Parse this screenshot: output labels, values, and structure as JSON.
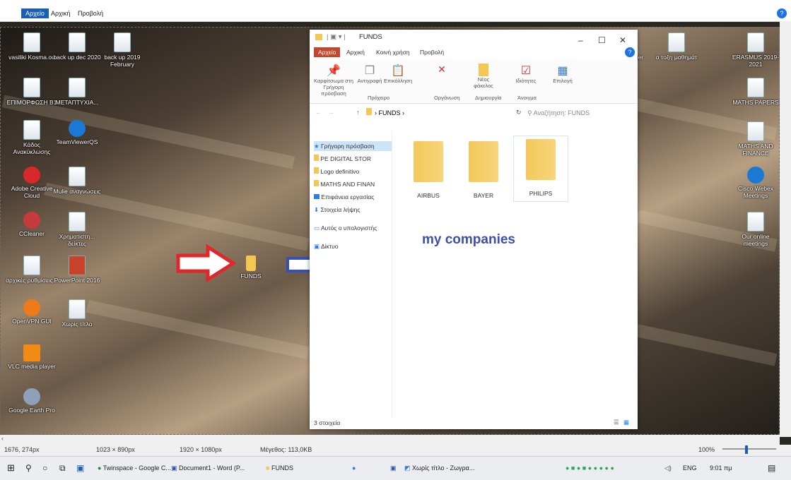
{
  "paint": {
    "tabs": [
      "Αρχείο",
      "Αρχική",
      "Προβολή"
    ]
  },
  "desktop_icons": [
    {
      "label": "vasiliki Kosma.ou"
    },
    {
      "label": "back up dec 2020"
    },
    {
      "label": "back up 2019 February"
    },
    {
      "label": "ΕΠΙΜΟΡΦΩΣΗ Β1"
    },
    {
      "label": "ΜΕΤΑΠΤΥΧΙΑ..."
    },
    {
      "label": "Κάδος Ανακύκλωσης"
    },
    {
      "label": "TeamViewerQS"
    },
    {
      "label": "Adobe Creative Cloud"
    },
    {
      "label": "Mulie αναγνώσεις"
    },
    {
      "label": "CCleaner"
    },
    {
      "label": "Χρηματιστη... δείκτες"
    },
    {
      "label": "αρχικές ρυθμίσεις..."
    },
    {
      "label": "PowerPoint 2016"
    },
    {
      "label": "OpenVPN GUI"
    },
    {
      "label": "Χωρίς τίτλο"
    },
    {
      "label": "VLC media player"
    },
    {
      "label": "Google Earth Pro"
    },
    {
      "label": "FUNDS"
    },
    {
      "label": "ger"
    },
    {
      "label": "α τοξη μαθημάτ"
    },
    {
      "label": "ERASMUS 2019-2021"
    },
    {
      "label": "MATHS PAPERS"
    },
    {
      "label": "MATHS AND FINANCE"
    },
    {
      "label": "Cisco Webex Meetings"
    },
    {
      "label": "Our online meetings"
    }
  ],
  "explorer": {
    "title": "FUNDS",
    "tabs": [
      "Αρχείο",
      "Αρχική",
      "Κοινή χρήση",
      "Προβολή"
    ],
    "ribbon": {
      "pin": "Καρφίτσωμα στη Γρήγορη πρόσβαση",
      "copy": "Αντιγραφή",
      "paste": "Επικόλληση",
      "new_folder": "Νέος φάκελος",
      "properties": "Ιδιότητες",
      "select": "Επιλογή",
      "groups": [
        "Πρόχειρο",
        "Οργάνωση",
        "Δημιουργία",
        "Άνοιγμα"
      ]
    },
    "address": "FUNDS",
    "search_placeholder": "Αναζήτηση: FUNDS",
    "nav": [
      "Γρήγορη πρόσβαση",
      "PE DIGITAL STOR",
      "Logo definitivo",
      "MATHS AND FINAN",
      "Επιφάνεια εργασίας",
      "Στοιχεία λήψης",
      "Αυτός ο υπολογιστής",
      "Δίκτυο"
    ],
    "folders": [
      "AIRBUS",
      "BAYER",
      "PHILIPS"
    ],
    "status": "3 στοιχεία"
  },
  "annotation": "my companies",
  "statusbar": {
    "cursor": "1676, 274px",
    "selection": "1023 × 890px",
    "image_size": "1920 × 1080px",
    "file_size": "Μέγεθος: 113,0KB",
    "zoom": "100%"
  },
  "taskbar": {
    "items": [
      "Twinspace - Google C...",
      "Document1 - Word (P...",
      "FUNDS",
      "Χωρίς τίτλο - Ζωγρα..."
    ],
    "lang": "ENG",
    "time": "9:01 πμ"
  },
  "colors": {
    "red_arrow": "#e0282c",
    "blue_arrow": "#3650b5",
    "annotation": "#3a4fb0",
    "folder": "#f3c752"
  }
}
